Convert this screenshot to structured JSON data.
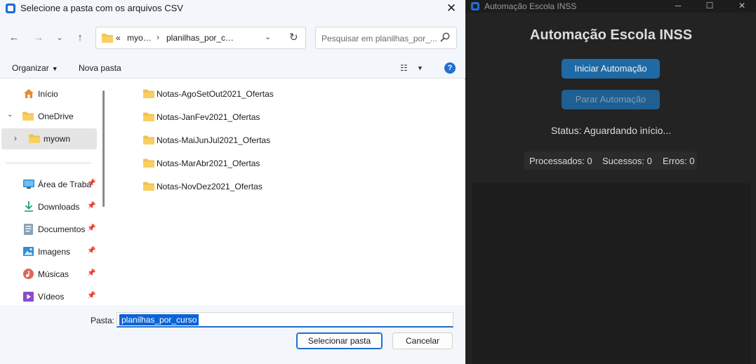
{
  "dialog": {
    "title": "Selecione a pasta com os arquivos CSV",
    "address": {
      "overflow": "«",
      "crumbs": [
        "myo…",
        "planilhas_por_c…"
      ]
    },
    "search_placeholder": "Pesquisar em planilhas_por_...",
    "toolbar": {
      "organize": "Organizar",
      "new_folder": "Nova pasta"
    },
    "sidebar": {
      "home": "Início",
      "onedrive": "OneDrive",
      "myown": "myown",
      "quick": [
        {
          "label": "Área de Traba",
          "icon": "desktop-icon"
        },
        {
          "label": "Downloads",
          "icon": "download-icon"
        },
        {
          "label": "Documentos",
          "icon": "document-icon"
        },
        {
          "label": "Imagens",
          "icon": "image-icon"
        },
        {
          "label": "Músicas",
          "icon": "music-icon"
        },
        {
          "label": "Vídeos",
          "icon": "video-icon"
        }
      ]
    },
    "files": [
      "Notas-AgoSetOut2021_Ofertas",
      "Notas-JanFev2021_Ofertas",
      "Notas-MaiJunJul2021_Ofertas",
      "Notas-MarAbr2021_Ofertas",
      "Notas-NovDez2021_Ofertas"
    ],
    "footer": {
      "folder_label": "Pasta:",
      "folder_value": "planilhas_por_curso",
      "select_button": "Selecionar pasta",
      "cancel_button": "Cancelar"
    }
  },
  "app": {
    "window_title": "Automação Escola INSS",
    "heading": "Automação Escola INSS",
    "start_button": "Iniciar Automação",
    "stop_button": "Parar Automação",
    "status": "Status: Aguardando início...",
    "stats": {
      "processed": "Processados: 0",
      "successes": "Sucessos: 0",
      "errors": "Erros: 0"
    }
  },
  "colors": {
    "accent": "#1f6fd1",
    "app_button": "#1f6aa5",
    "app_background": "#232323",
    "folder_yellow": "#f2c14e"
  }
}
